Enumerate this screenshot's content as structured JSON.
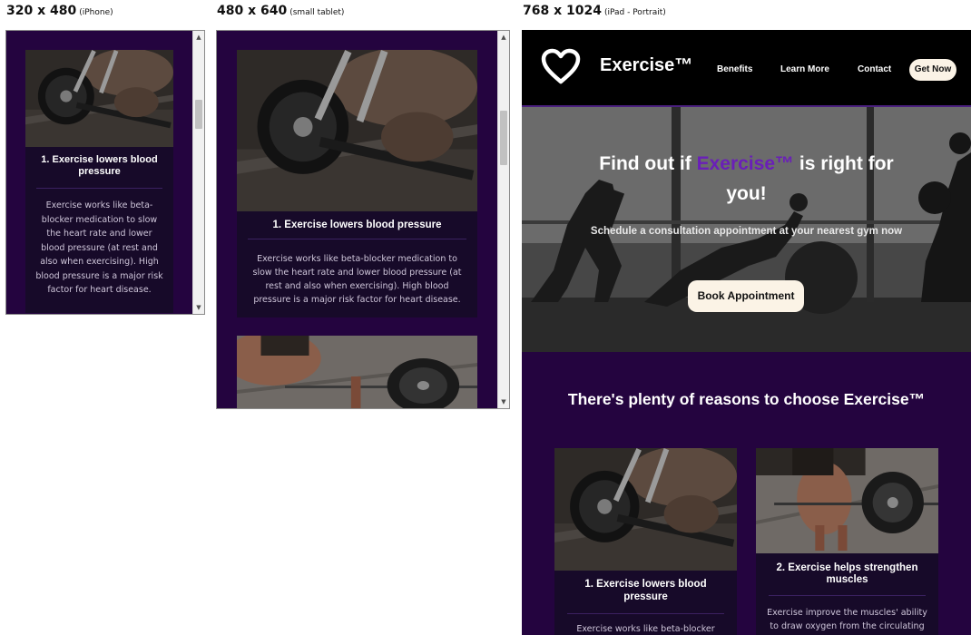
{
  "frames": {
    "iphone": {
      "size": "320 x 480",
      "device": "(iPhone)"
    },
    "tablet": {
      "size": "480 x 640",
      "device": "(small tablet)"
    },
    "ipad": {
      "size": "768 x 1024",
      "device": "(iPad - Portrait)"
    }
  },
  "cards": {
    "card1": {
      "title": "1. Exercise lowers blood pressure",
      "text": "Exercise works like beta-blocker medication to slow the heart rate and lower blood pressure (at rest and also when exercising). High blood pressure is a major risk factor for heart disease.",
      "text_cut": "Exercise works like beta-blocker"
    },
    "card2": {
      "title": "2. Exercise helps strengthen muscles",
      "text_cut": "Exercise improve the muscles' ability to draw oxygen from the circulating"
    }
  },
  "nav": {
    "brand": "Exercise™",
    "links": [
      "Benefits",
      "Learn More",
      "Contact"
    ],
    "cta": "Get Now"
  },
  "hero": {
    "title_before": "Find out if",
    "title_accent": "Exercise™",
    "title_after": "is right for you!",
    "subtitle": "Schedule a consultation appointment at your nearest gym now",
    "button": "Book Appointment"
  },
  "reasons": {
    "title": "There's plenty of reasons to choose Exercise™"
  },
  "colors": {
    "page_bg": "#24043f",
    "card_bg": "#170a29",
    "accent": "#6a1fb8",
    "button_bg": "#fbf3e6",
    "nav_bg": "#000000"
  }
}
